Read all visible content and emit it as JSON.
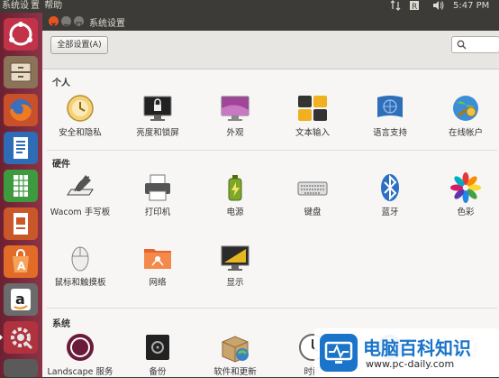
{
  "topbar": {
    "menu": [
      "系统设",
      "置",
      "帮助"
    ],
    "time": "5:47 PM"
  },
  "window": {
    "title": "系统设置",
    "all_settings_label": "全部设置(A)",
    "search": {
      "placeholder": ""
    }
  },
  "sections": {
    "personal": {
      "title": "个人",
      "items": [
        {
          "label": "安全和隐私",
          "icon": "security-privacy-icon"
        },
        {
          "label": "亮度和锁屏",
          "icon": "brightness-lock-icon"
        },
        {
          "label": "外观",
          "icon": "appearance-icon"
        },
        {
          "label": "文本输入",
          "icon": "text-entry-icon"
        },
        {
          "label": "语言支持",
          "icon": "language-support-icon"
        },
        {
          "label": "在线帐户",
          "icon": "online-accounts-icon"
        }
      ]
    },
    "hardware": {
      "title": "硬件",
      "items": [
        {
          "label": "Wacom 手写板",
          "icon": "wacom-tablet-icon"
        },
        {
          "label": "打印机",
          "icon": "printer-icon"
        },
        {
          "label": "电源",
          "icon": "power-icon"
        },
        {
          "label": "键盘",
          "icon": "keyboard-icon"
        },
        {
          "label": "蓝牙",
          "icon": "bluetooth-icon"
        },
        {
          "label": "色彩",
          "icon": "color-icon"
        },
        {
          "label": "鼠标和触摸板",
          "icon": "mouse-touchpad-icon"
        },
        {
          "label": "网络",
          "icon": "network-icon"
        },
        {
          "label": "显示",
          "icon": "display-icon"
        }
      ]
    },
    "system": {
      "title": "系统",
      "items": [
        {
          "label": "Landscape 服务",
          "icon": "landscape-service-icon"
        },
        {
          "label": "备份",
          "icon": "backup-icon"
        },
        {
          "label": "软件和更新",
          "icon": "software-updates-icon"
        },
        {
          "label": "时间",
          "icon": "time-date-icon"
        },
        {
          "label": "",
          "icon": "universal-access-icon"
        },
        {
          "label": "",
          "icon": "details-icon"
        }
      ]
    }
  },
  "watermark": {
    "main": "电脑百科知识",
    "url": "www.pc-daily.com"
  },
  "colors": {
    "launcher": "#7b2a3a",
    "panel": "#3c3b37",
    "close_button": "#e8541e",
    "watermark_blue": "#1a74c9"
  }
}
